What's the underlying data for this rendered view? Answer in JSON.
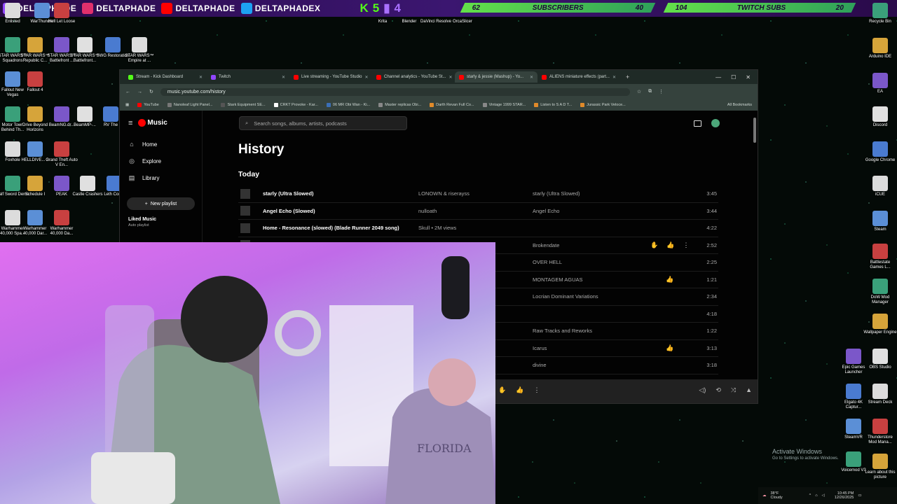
{
  "overlay": {
    "socials": [
      {
        "name": "DELTAPHADE",
        "icon": "twitch-icon",
        "color": "#9146ff"
      },
      {
        "name": "DELTAPHADE",
        "icon": "instagram-icon",
        "color": "#e1306c"
      },
      {
        "name": "DELTAPHADE",
        "icon": "youtube-icon",
        "color": "#ff0000"
      },
      {
        "name": "DELTAPHADEX",
        "icon": "twitter-icon",
        "color": "#1da1f2"
      }
    ],
    "kick_count": "5",
    "twitch_count": "4",
    "subscribers": {
      "current": "62",
      "label": "SUBSCRIBERS",
      "goal_a": "40"
    },
    "twitch_subs": {
      "current": "104",
      "label": "TWITCH SUBS",
      "goal": "20"
    }
  },
  "desktop_icons_left": [
    "Enlisted",
    "WarThunder",
    "Hell Let Loose",
    "STAR WARS™ Squadrons",
    "STAR WARS™ Republic C...",
    "STAR WARS™ Battlefront ...",
    "STAR WARS™ Battlefront...",
    "SWG Restoration",
    "STAR WARS™ Empire at ...",
    "Fallout New Vegas",
    "Fallout 4",
    "Motor Town Behind Th...",
    "Drive Beyond Horizons",
    "BeamNG.dr...",
    "BeamMP-...",
    "RV The",
    "Foxhole",
    "HELLDIVE... 2",
    "Grand Theft Auto V En...",
    "Half Sword Demo",
    "Schedule I",
    "PEAK",
    "Castle Crashers",
    "Leth Comp",
    "Warhammer 40,000 Spa...",
    "Warhammer 40,000 Dar...",
    "Warhammer 40,000 Da..."
  ],
  "desktop_icons_top": [
    "Krita",
    "Blender",
    "DaVinci Resolve",
    "OrcaSlicer"
  ],
  "desktop_icons_right": [
    "Recycle Bin",
    "Arduino IDE",
    "EA",
    "Discord",
    "Google Chrome",
    "iCUE",
    "Steam",
    "Battlestate Games L...",
    "DoW Mod Manager",
    "Wallpaper Engine",
    "Epic Games Launcher",
    "OBS Studio",
    "Elgato 4K Captur...",
    "Stream Deck",
    "SteamVR",
    "Thunderstore Mod Mana...",
    "Voicemod V3",
    "Learn about this picture"
  ],
  "browser": {
    "tabs": [
      {
        "label": "Stream - Kick Dashboard",
        "color": "#53fc18",
        "active": false
      },
      {
        "label": "Twitch",
        "color": "#9146ff",
        "active": false
      },
      {
        "label": "Live streaming - YouTube Studio",
        "color": "#ff0000",
        "active": false
      },
      {
        "label": "Channel analytics - YouTube St...",
        "color": "#ff0000",
        "active": false
      },
      {
        "label": "starly & jessie (Mashup) - Yo...",
        "color": "#ff0000",
        "active": true
      },
      {
        "label": "ALIENS miniature effects (part...",
        "color": "#ff0000",
        "active": false
      }
    ],
    "url": "music.youtube.com/history",
    "bookmarks": [
      {
        "label": "YouTube",
        "color": "#ff0000"
      },
      {
        "label": "Nanoleaf Light Panel...",
        "color": "#777777"
      },
      {
        "label": "Stark Equipment SE...",
        "color": "#555555"
      },
      {
        "label": "CRKT Provoke - Kar...",
        "color": "#ffffff"
      },
      {
        "label": "06 MR Obi Wan - Ki...",
        "color": "#3b6fb6"
      },
      {
        "label": "Master replicas Obi...",
        "color": "#888888"
      },
      {
        "label": "Darth Revan Full Co...",
        "color": "#e08a2a"
      },
      {
        "label": "Vintage 1999 STAR...",
        "color": "#888888"
      },
      {
        "label": "Listen to S A D T...",
        "color": "#e08a2a"
      },
      {
        "label": "Jurassic Park Veloce...",
        "color": "#e08a2a"
      }
    ],
    "all_bookmarks": "All Bookmarks"
  },
  "ytm": {
    "brand": "Music",
    "nav": [
      {
        "label": "Home",
        "icon": "home-icon"
      },
      {
        "label": "Explore",
        "icon": "explore-icon"
      },
      {
        "label": "Library",
        "icon": "library-icon"
      }
    ],
    "new_playlist": "New playlist",
    "liked_title": "Liked Music",
    "liked_sub": "Auto playlist",
    "search_placeholder": "Search songs, albums, artists, podcasts",
    "page_title": "History",
    "section": "Today",
    "rows": [
      {
        "song": "starly (Ultra Slowed)",
        "artist": "LONOWN & riserayss",
        "album": "starly (Ultra Slowed)",
        "duration": "3:45"
      },
      {
        "song": "Angel Echo (Slowed)",
        "artist": "nulloath",
        "album": "Angel Echo",
        "duration": "3:44"
      },
      {
        "song": "Home - Resonance (slowed) (Blade Runner 2049 song)",
        "artist": "Skull • 2M views",
        "album": "",
        "duration": "4:22"
      },
      {
        "song": "",
        "artist": "",
        "album": "Brokendate",
        "duration": "2:52"
      },
      {
        "song": "",
        "artist": "",
        "album": "OVER HELL",
        "duration": "2:25"
      },
      {
        "song": "",
        "artist": "",
        "album": "MONTAGEM AGUAS",
        "duration": "1:21"
      },
      {
        "song": "",
        "artist": "",
        "album": "Locrian Dominant Variations",
        "duration": "2:34"
      },
      {
        "song": "",
        "artist": "",
        "album": "",
        "duration": "4:18"
      },
      {
        "song": "",
        "artist": "",
        "album": "Raw Tracks and Reworks",
        "duration": "1:22"
      },
      {
        "song": "",
        "artist": "",
        "album": "Icarus",
        "duration": "3:13"
      },
      {
        "song": "",
        "artist": "",
        "album": "divine",
        "duration": "3:18"
      }
    ]
  },
  "webcam": {
    "shirt_text": "FLORIDA"
  },
  "activate": {
    "line1": "Activate Windows",
    "line2": "Go to Settings to activate Windows."
  },
  "tray": {
    "temp": "38°F",
    "weather": "Cloudy",
    "time": "10:45 PM",
    "date": "12/26/2025"
  }
}
